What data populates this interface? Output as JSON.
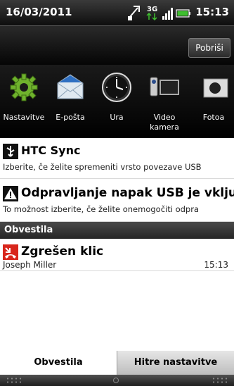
{
  "status_bar": {
    "date": "16/03/2011",
    "time": "15:13",
    "network": "3G",
    "icons": [
      "usb-debug-icon",
      "3g-data-icon",
      "signal-icon",
      "battery-icon"
    ]
  },
  "header": {
    "clear_label": "Pobriši"
  },
  "quick_launch": [
    {
      "label": "Nastavitve",
      "icon": "settings-gear-icon"
    },
    {
      "label": "E-pošta",
      "icon": "email-envelope-icon"
    },
    {
      "label": "Ura",
      "icon": "clock-icon"
    },
    {
      "label": "Video kamera",
      "icon": "video-camera-icon"
    },
    {
      "label": "Fotoa",
      "icon": "camera-icon"
    }
  ],
  "notifications": {
    "ongoing": [
      {
        "title": "HTC Sync",
        "subtitle": "Izberite, če želite spremeniti vrsto povezave USB",
        "icon": "usb-icon"
      },
      {
        "title": "Odpravljanje napak USB je vključ",
        "subtitle": "To možnost izberite, če želite onemogočiti odpra",
        "icon": "warning-icon"
      }
    ],
    "section_label": "Obvestila",
    "items": [
      {
        "title": "Zgrešen klic",
        "subtitle": "Joseph Miller",
        "time": "15:13",
        "icon": "missed-call-icon"
      }
    ]
  },
  "tabs": [
    {
      "label": "Obvestila",
      "active": true
    },
    {
      "label": "Hitre nastavitve",
      "active": false
    }
  ],
  "colors": {
    "accent_green": "#3fbf2f",
    "missed_call_red": "#d8261c",
    "tab_active_bg": "#ffffff"
  }
}
